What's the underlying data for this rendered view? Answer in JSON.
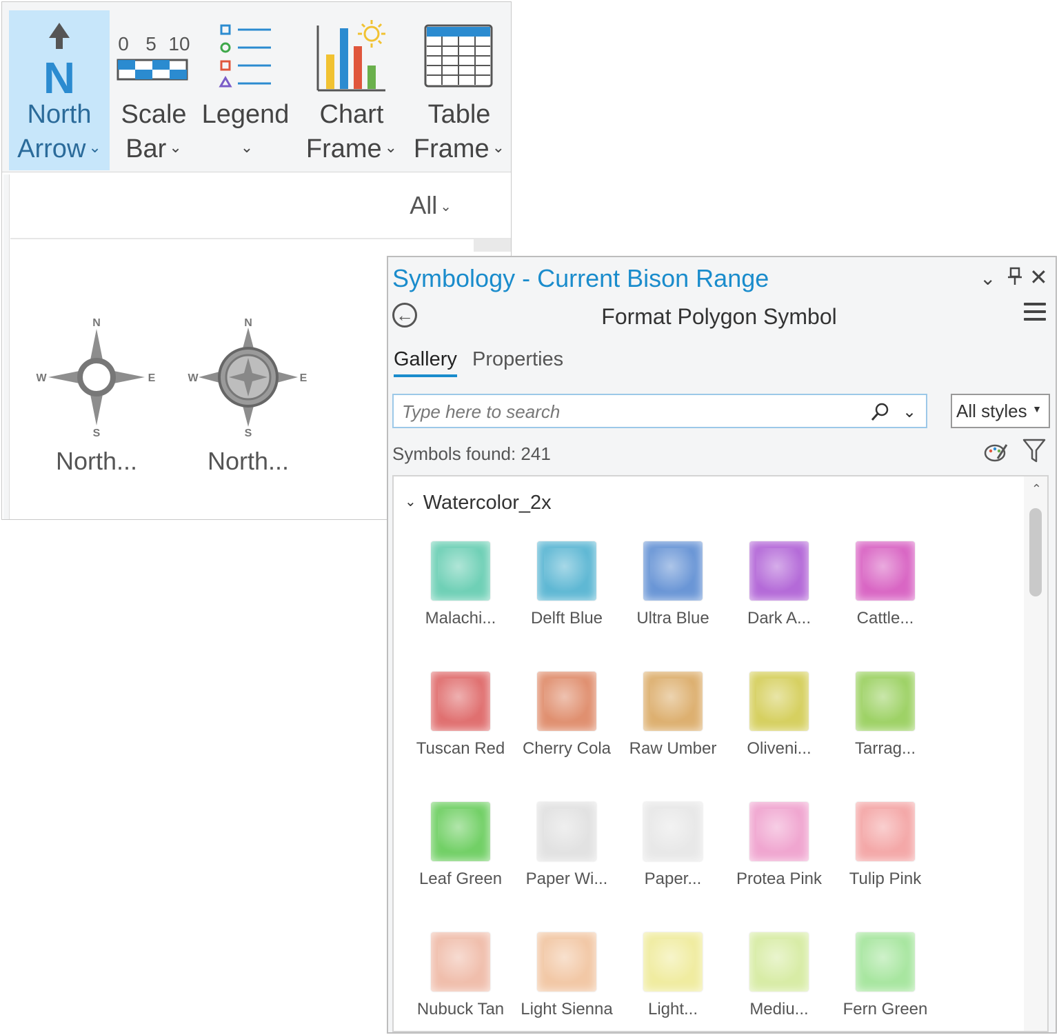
{
  "ribbon": {
    "north_arrow": {
      "line1": "North",
      "line2": "Arrow"
    },
    "scale_bar": {
      "line1": "Scale",
      "line2": "Bar",
      "ticks": [
        "0",
        "5",
        "10"
      ]
    },
    "legend": {
      "line1": "Legend"
    },
    "chart_frame": {
      "line1": "Chart",
      "line2": "Frame"
    },
    "table_frame": {
      "line1": "Table",
      "line2": "Frame"
    }
  },
  "north_gallery": {
    "filter": "All",
    "items": [
      {
        "label": "North...",
        "letters": {
          "n": "N",
          "s": "S",
          "e": "E",
          "w": "W"
        }
      },
      {
        "label": "North...",
        "letters": {
          "n": "N",
          "s": "S",
          "e": "E",
          "w": "W"
        }
      }
    ]
  },
  "symbology": {
    "title": "Symbology - Current Bison Range",
    "subtitle": "Format Polygon Symbol",
    "tabs": [
      "Gallery",
      "Properties"
    ],
    "search_placeholder": "Type here to search",
    "styles_filter": "All styles",
    "symbols_found": "Symbols found: 241",
    "group": "Watercolor_2x",
    "symbols": [
      {
        "label": "Malachi...",
        "color": "#6fd0b6"
      },
      {
        "label": "Delft Blue",
        "color": "#5fb8d4"
      },
      {
        "label": "Ultra Blue",
        "color": "#6a96d6"
      },
      {
        "label": "Dark A...",
        "color": "#b46ad8"
      },
      {
        "label": "Cattle...",
        "color": "#d966c4"
      },
      {
        "label": "Tuscan Red",
        "color": "#e07070"
      },
      {
        "label": "Cherry Cola",
        "color": "#e09070"
      },
      {
        "label": "Raw Umber",
        "color": "#ddb070"
      },
      {
        "label": "Oliveni...",
        "color": "#d6d060"
      },
      {
        "label": "Tarrag...",
        "color": "#9ed266"
      },
      {
        "label": "Leaf Green",
        "color": "#72d066"
      },
      {
        "label": "Paper Wi...",
        "color": "#e2e2e2"
      },
      {
        "label": "Paper...",
        "color": "#e8e8e8"
      },
      {
        "label": "Protea Pink",
        "color": "#f0a6d0"
      },
      {
        "label": "Tulip Pink",
        "color": "#f4a8a8"
      },
      {
        "label": "Nubuck Tan",
        "color": "#f0beac"
      },
      {
        "label": "Light Sienna",
        "color": "#f2c8a6"
      },
      {
        "label": "Light...",
        "color": "#f0eca0"
      },
      {
        "label": "Mediu...",
        "color": "#d8eca6"
      },
      {
        "label": "Fern Green",
        "color": "#a8e6a0"
      }
    ]
  }
}
